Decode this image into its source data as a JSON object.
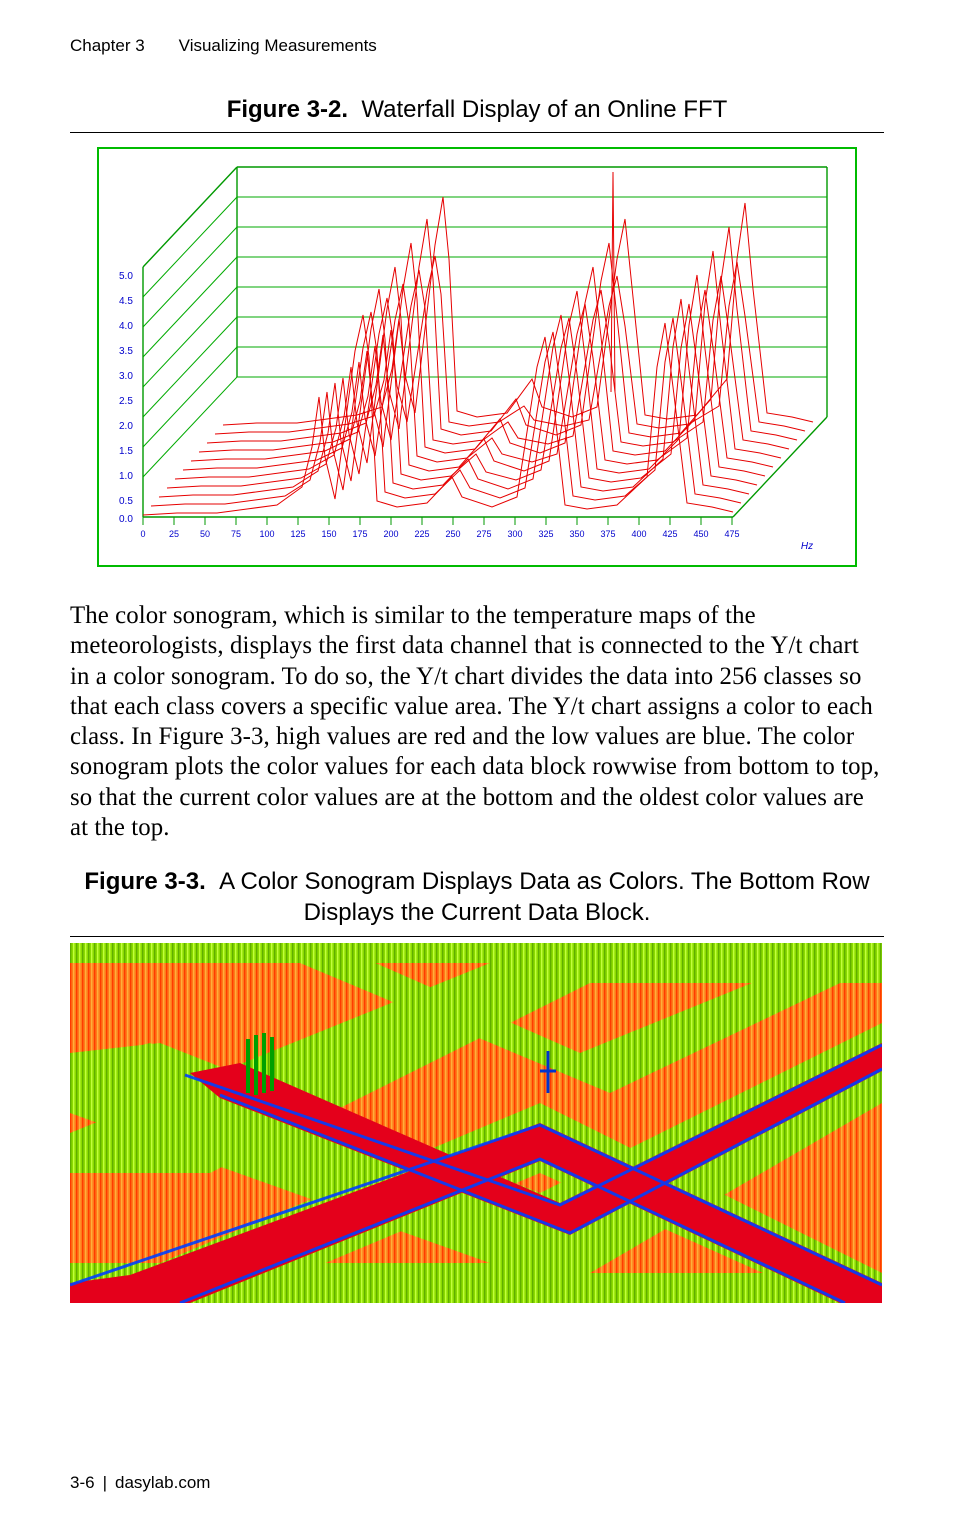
{
  "header": {
    "chapter": "Chapter 3",
    "title": "Visualizing Measurements"
  },
  "figure1": {
    "label": "Figure 3-2.",
    "caption": "Waterfall Display of an Online FFT",
    "y_ticks": [
      "5.0",
      "4.5",
      "4.0",
      "3.5",
      "3.0",
      "2.5",
      "2.0",
      "1.5",
      "1.0",
      "0.5",
      "0.0"
    ],
    "x_ticks": [
      "0",
      "25",
      "50",
      "75",
      "100",
      "125",
      "150",
      "175",
      "200",
      "225",
      "250",
      "275",
      "300",
      "325",
      "350",
      "375",
      "400",
      "425",
      "450",
      "475"
    ],
    "x_unit": "Hz"
  },
  "body": "The color sonogram, which is similar to the temperature maps of the meteorologists, displays the first data channel that is connected to the Y/t chart in a color sonogram. To do so, the Y/t chart divides the data into 256 classes so that each class covers a specific value area. The Y/t chart assigns a color to each class. In Figure 3-3, high values are red and the low values are blue. The color sonogram plots the color values for each data block rowwise from bottom to top, so that the current color values are at the bottom and the oldest color values are at the top.",
  "figure2": {
    "label": "Figure 3-3.",
    "caption_line1": "A Color Sonogram Displays Data as Colors. The Bottom Row",
    "caption_line2": "Displays the Current Data Block."
  },
  "footer": {
    "page": "3-6",
    "site": "dasylab.com"
  }
}
